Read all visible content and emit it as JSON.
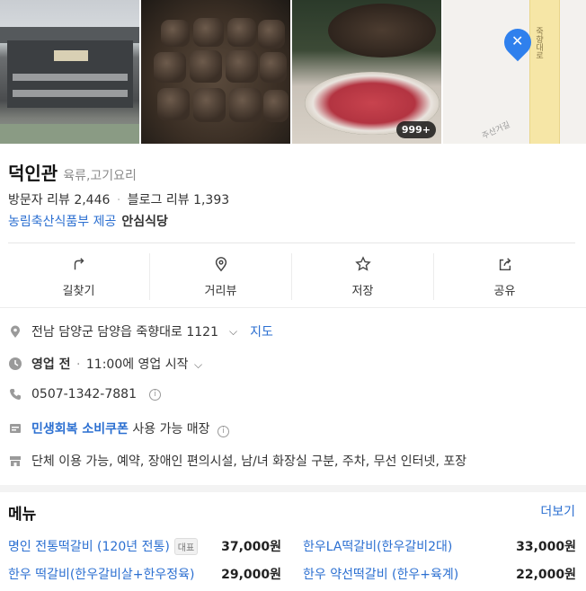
{
  "photos": {
    "count_badge": "999+"
  },
  "map": {
    "road_label": "죽향대로",
    "road2_label": "주산거길"
  },
  "place": {
    "name": "덕인관",
    "category": "육류,고기요리",
    "visitor_reviews_label": "방문자 리뷰",
    "visitor_reviews": "2,446",
    "blog_reviews_label": "블로그 리뷰",
    "blog_reviews": "1,393",
    "provider_text": "농림축산식품부 제공",
    "provider_badge": "안심식당"
  },
  "actions": [
    {
      "label": "길찾기",
      "icon": "directions-icon"
    },
    {
      "label": "거리뷰",
      "icon": "streetview-pin-icon"
    },
    {
      "label": "저장",
      "icon": "star-icon"
    },
    {
      "label": "공유",
      "icon": "share-icon"
    }
  ],
  "details": {
    "address": "전남 담양군 담양읍 죽향대로 1121",
    "map_link": "지도",
    "status": "영업 전",
    "hours": "11:00에 영업 시작",
    "phone": "0507-1342-7881",
    "coupon_label": "민생회복 소비쿠폰",
    "coupon_text": "사용 가능 매장",
    "amenities": "단체 이용 가능, 예약, 장애인 편의시설, 남/녀 화장실 구분, 주차, 무선 인터넷, 포장"
  },
  "menu": {
    "title": "메뉴",
    "more": "더보기",
    "rep_badge": "대표",
    "items": [
      {
        "name": "명인 전통떡갈비 (120년 전통)",
        "price": "37,000원"
      },
      {
        "name": "한우LA떡갈비(한우갈비2대)",
        "price": "33,000원"
      },
      {
        "name": "한우 떡갈비(한우갈비살+한우정육)",
        "price": "29,000원"
      },
      {
        "name": "한우 약선떡갈비 (한우+육계)",
        "price": "22,000원"
      }
    ]
  },
  "colors": {
    "link": "#2b6fd1",
    "text": "#222222",
    "muted": "#8a8a8a"
  }
}
